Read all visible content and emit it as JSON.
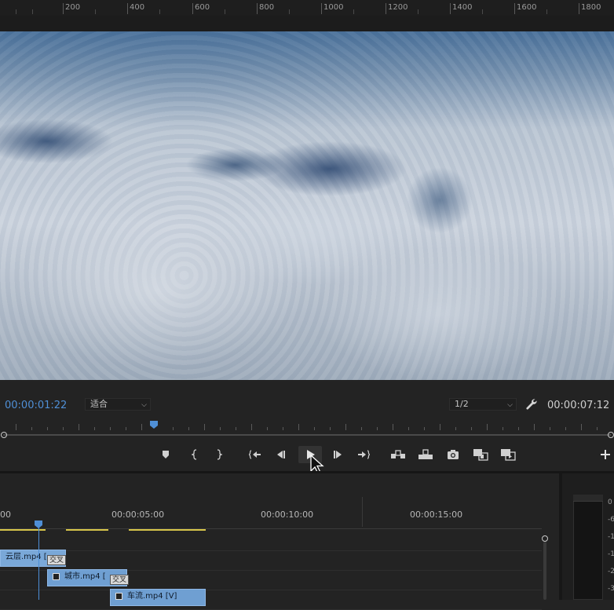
{
  "ruler": {
    "labels": [
      "200",
      "400",
      "600",
      "800",
      "1000",
      "1200",
      "1400",
      "1600",
      "1800"
    ]
  },
  "monitor": {
    "timecode_current": "00:00:01:22",
    "zoom_select": "适合",
    "resolution_select": "1/2",
    "timecode_duration": "00:00:07:12"
  },
  "transport": {
    "buttons": [
      "add-marker",
      "mark-in",
      "mark-out",
      "go-to-in",
      "step-back",
      "play",
      "step-forward",
      "go-to-out",
      "insert",
      "overwrite",
      "export-frame",
      "comparison-view",
      "proxy-toggle",
      "add-button"
    ]
  },
  "timeline": {
    "time_labels": [
      "00",
      "00:00:05:00",
      "00:00:10:00",
      "00:00:15:00"
    ],
    "clips": [
      {
        "name": "云层.mp4 [",
        "transition": "交叉"
      },
      {
        "name": "城市.mp4 [",
        "transition": "交叉"
      },
      {
        "name": "车流.mp4 [V]"
      }
    ]
  },
  "meter": {
    "labels": [
      "0",
      "-6",
      "-1",
      "-1",
      "-2",
      "-3"
    ]
  },
  "colors": {
    "accent_blue": "#4f8fd6",
    "clip_blue": "#6f9fd2",
    "work_area_yellow": "#d8c64a"
  }
}
